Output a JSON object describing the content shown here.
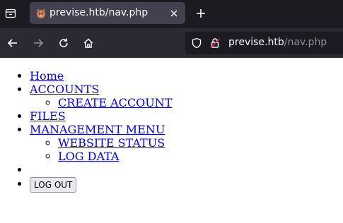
{
  "browser": {
    "tab": {
      "title": "previse.htb/nav.php"
    },
    "urlbar": {
      "host": "previse.htb",
      "path": "/nav.php"
    },
    "colors": {
      "tabbar_bg": "#1c1b22",
      "active_tab_bg": "#42414d",
      "navbar_bg": "#2b2a33",
      "text": "#fbfbfe",
      "dim_text": "#8f8f9d",
      "lock_accent": "#e22850"
    }
  },
  "page": {
    "nav": {
      "home": "Home",
      "accounts": "ACCOUNTS",
      "create_account": "CREATE ACCOUNT",
      "files": "FILES",
      "management_menu": "MANAGEMENT MENU",
      "website_status": "WEBSITE STATUS",
      "log_data": "LOG DATA"
    },
    "logout_button": "LOG OUT",
    "link_color": "#0000ee"
  }
}
